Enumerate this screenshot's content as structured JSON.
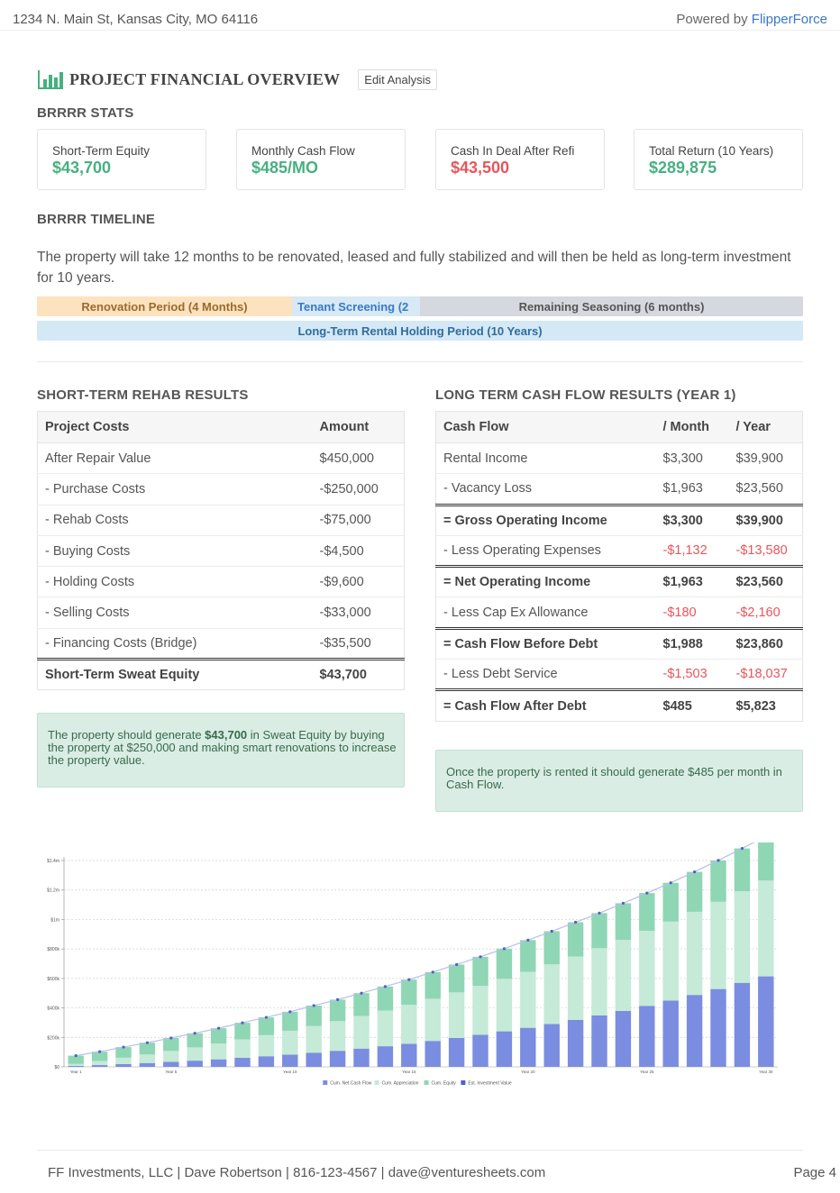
{
  "header": {
    "address": "1234 N. Main St, Kansas City, MO 64116",
    "powered_prefix": "Powered by ",
    "brand": "FlipperForce"
  },
  "page": {
    "title": "PROJECT FINANCIAL OVERVIEW",
    "edit_label": "Edit Analysis",
    "icon": "bar-chart-icon"
  },
  "stats": {
    "heading": "BRRRR STATS",
    "items": [
      {
        "label": "Short-Term Equity",
        "value": "$43,700",
        "tone": "green"
      },
      {
        "label": "Monthly Cash Flow",
        "value": "$485/MO",
        "tone": "green"
      },
      {
        "label": "Cash In Deal After Refi",
        "value": "$43,500",
        "tone": "red"
      },
      {
        "label": "Total Return (10 Years)",
        "value": "$289,875",
        "tone": "green"
      }
    ]
  },
  "timeline": {
    "heading": "BRRRR TIMELINE",
    "text": "The property will take 12 months to be renovated, leased and fully stabilized and will then be held as long-term investment for 10 years.",
    "renovation": "Renovation Period (4 Months)",
    "tenant": "Tenant Screening (2",
    "seasoning": "Remaining Seasoning (6 months)",
    "rental": "Long-Term Rental Holding Period (10 Years)"
  },
  "rehab": {
    "heading": "SHORT-TERM REHAB RESULTS",
    "col_costs": "Project Costs",
    "col_amount": "Amount",
    "rows": [
      {
        "label": "After Repair Value",
        "value": "$450,000"
      },
      {
        "label": "- Purchase Costs",
        "value": "-$250,000"
      },
      {
        "label": "- Rehab Costs",
        "value": "-$75,000"
      },
      {
        "label": "- Buying Costs",
        "value": "-$4,500"
      },
      {
        "label": "- Holding Costs",
        "value": "-$9,600"
      },
      {
        "label": "- Selling Costs",
        "value": "-$33,000"
      },
      {
        "label": "- Financing Costs (Bridge)",
        "value": "-$35,500"
      }
    ],
    "total_label": "Short-Term Sweat Equity",
    "total_value": "$43,700",
    "note_a": "The property should generate ",
    "note_b": "$43,700",
    "note_c": " in Sweat Equity by buying the property at $250,000 and making smart renovations to increase the property value."
  },
  "cashflow": {
    "heading": "LONG TERM CASH FLOW RESULTS (YEAR 1)",
    "col_flow": "Cash Flow",
    "col_month": "/ Month",
    "col_year": "/ Year",
    "rows": [
      {
        "label": "Rental Income",
        "month": "$3,300",
        "year": "$39,900",
        "style": "normal",
        "tone": ""
      },
      {
        "label": "- Vacancy Loss",
        "month": "$1,963",
        "year": "$23,560",
        "style": "normal",
        "tone": ""
      },
      {
        "label": "= Gross Operating Income",
        "month": "$3,300",
        "year": "$39,900",
        "style": "total",
        "tone": ""
      },
      {
        "label": "- Less Operating Expenses",
        "month": "-$1,132",
        "year": "-$13,580",
        "style": "normal",
        "tone": "red"
      },
      {
        "label": "= Net Operating Income",
        "month": "$1,963",
        "year": "$23,560",
        "style": "total",
        "tone": ""
      },
      {
        "label": "- Less Cap Ex Allowance",
        "month": "-$180",
        "year": "-$2,160",
        "style": "normal",
        "tone": "red"
      },
      {
        "label": "= Cash Flow Before Debt",
        "month": "$1,988",
        "year": "$23,860",
        "style": "total",
        "tone": ""
      },
      {
        "label": "- Less Debt Service",
        "month": "-$1,503",
        "year": "-$18,037",
        "style": "normal",
        "tone": "red"
      },
      {
        "label": "= Cash Flow After Debt",
        "month": "$485",
        "year": "$5,823",
        "style": "total",
        "tone": "green"
      }
    ],
    "note": "Once the property is rented it should generate $485 per month in Cash Flow."
  },
  "chart_data": {
    "type": "bar",
    "stacked": true,
    "categories": [
      "Year 1",
      "Year 2",
      "Year 3",
      "Year 4",
      "Year 5",
      "Year 6",
      "Year 7",
      "Year 8",
      "Year 9",
      "Year 10",
      "Year 11",
      "Year 12",
      "Year 13",
      "Year 14",
      "Year 15",
      "Year 16",
      "Year 17",
      "Year 18",
      "Year 19",
      "Year 20",
      "Year 21",
      "Year 22",
      "Year 23",
      "Year 24",
      "Year 25",
      "Year 26",
      "Year 27",
      "Year 28",
      "Year 29",
      "Year 30"
    ],
    "tick_labels": [
      "Year 1",
      "Year 5",
      "Year 10",
      "Year 15",
      "Year 20",
      "Year 25",
      "Year 30"
    ],
    "series": [
      {
        "name": "Cum. Net Cash Flow",
        "color": "#7b8de0",
        "values": [
          6,
          12,
          19,
          26,
          34,
          42,
          51,
          61,
          72,
          83,
          96,
          109,
          124,
          140,
          157,
          176,
          196,
          218,
          241,
          265,
          291,
          319,
          349,
          380,
          414,
          450,
          488,
          528,
          570,
          614
        ]
      },
      {
        "name": "Cum. Appreciation",
        "color": "#c5ead7",
        "values": [
          14,
          28,
          43,
          58,
          74,
          90,
          107,
          125,
          143,
          162,
          181,
          201,
          221,
          242,
          264,
          286,
          309,
          332,
          356,
          380,
          405,
          430,
          456,
          482,
          509,
          536,
          564,
          592,
          621,
          650
        ]
      },
      {
        "name": "Cum. Equity",
        "color": "#8fd6b4",
        "values": [
          56,
          63,
          72,
          80,
          88,
          96,
          104,
          113,
          121,
          129,
          139,
          146,
          155,
          163,
          171,
          181,
          189,
          197,
          205,
          215,
          224,
          232,
          238,
          248,
          256,
          263,
          271,
          281,
          291,
          301
        ]
      }
    ],
    "line": {
      "name": "Est. Investment Value",
      "color": "#4a63c7",
      "values": [
        76,
        103,
        134,
        164,
        196,
        228,
        262,
        299,
        336,
        374,
        416,
        456,
        500,
        545,
        592,
        643,
        694,
        747,
        802,
        860,
        920,
        981,
        1043,
        1110,
        1179,
        1249,
        1323,
        1401,
        1482,
        1565
      ]
    },
    "y_ticks": [
      "$0",
      "$200k",
      "$400k",
      "$600k",
      "$800k",
      "$1m",
      "$1.2m",
      "$1.4m"
    ],
    "ylim": [
      0,
      1400
    ],
    "grid": true,
    "legend": "bottom"
  },
  "footer": {
    "left": "FF Investments, LLC | Dave Robertson | 816-123-4567 | dave@venturesheets.com",
    "page": "Page 4"
  }
}
